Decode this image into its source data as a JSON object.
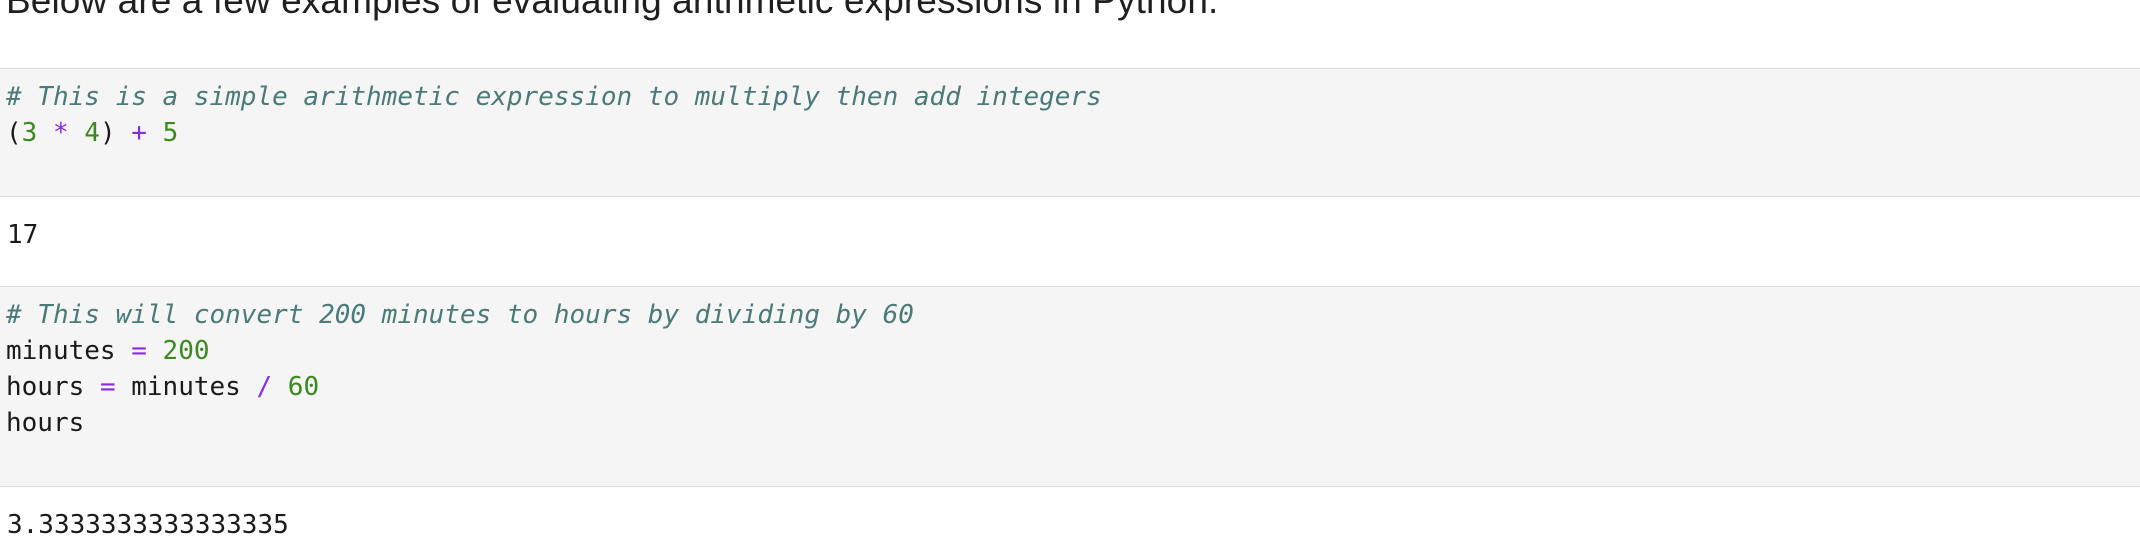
{
  "intro_text": "Below are a few examples of evaluating arithmetic expressions in Python.",
  "cells": [
    {
      "comment": "# This is a simple arithmetic expression to multiply then add integers",
      "expr": {
        "open_paren": "(",
        "a": "3",
        "mul": "*",
        "b": "4",
        "close_paren": ")",
        "add": "+",
        "c": "5"
      },
      "output": "17"
    },
    {
      "comment": "# This will convert 200 minutes to hours by dividing by 60",
      "line1": {
        "name": "minutes",
        "eq": "=",
        "value": "200"
      },
      "line2": {
        "name": "hours",
        "eq": "=",
        "lhs": "minutes",
        "div": "/",
        "value": "60"
      },
      "line3": {
        "name": "hours"
      },
      "output": "3.3333333333333335"
    }
  ],
  "colors": {
    "comment": "#4b7a7a",
    "number": "#3b8a1f",
    "operator": "#8a2be2",
    "code_bg": "#f5f5f5",
    "border": "#dcdcdc"
  }
}
